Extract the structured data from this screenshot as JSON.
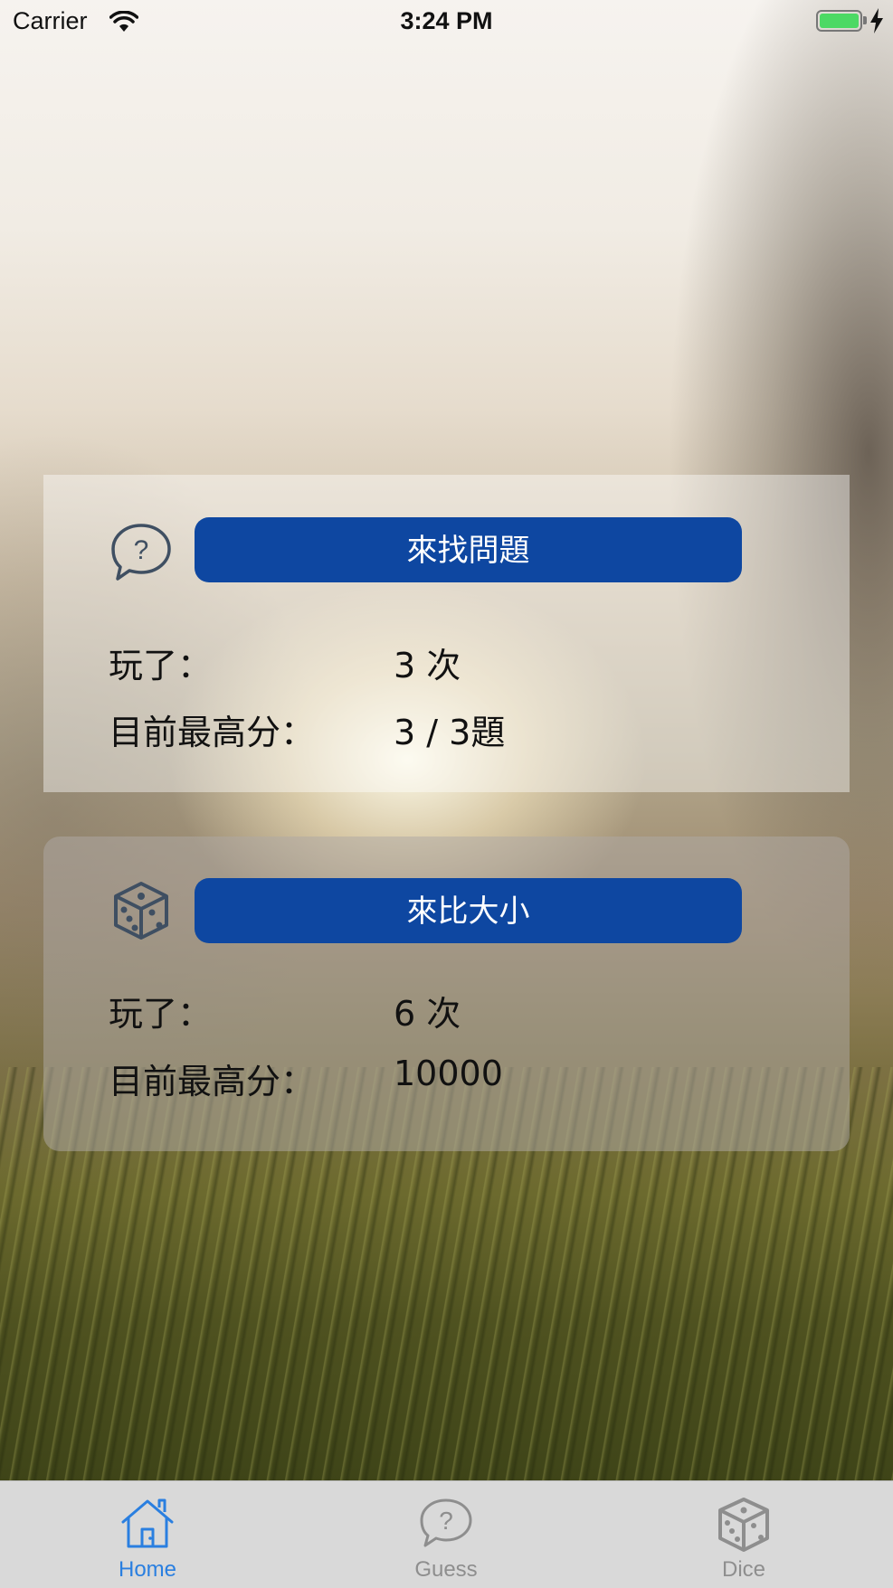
{
  "status_bar": {
    "carrier": "Carrier",
    "time": "3:24 PM"
  },
  "cards": {
    "guess": {
      "icon": "speech-bubble-question-icon",
      "button_label": "來找問題",
      "played_label": "玩了：",
      "played_value": "3 次",
      "best_label": "目前最高分：",
      "best_value": "3 / 3題"
    },
    "dice": {
      "icon": "dice-icon",
      "button_label": "來比大小",
      "played_label": "玩了：",
      "played_value": "6 次",
      "best_label": "目前最高分：",
      "best_value": "10000"
    }
  },
  "tab_bar": {
    "tabs": [
      {
        "label": "Home",
        "icon": "house-icon",
        "selected": true
      },
      {
        "label": "Guess",
        "icon": "speech-bubble-question-icon",
        "selected": false
      },
      {
        "label": "Dice",
        "icon": "dice-icon",
        "selected": false
      }
    ]
  },
  "colors": {
    "button": "#0e47a1",
    "tab_active": "#2a7fe0",
    "tab_inactive": "#8e8e8e",
    "battery": "#4cd964"
  }
}
